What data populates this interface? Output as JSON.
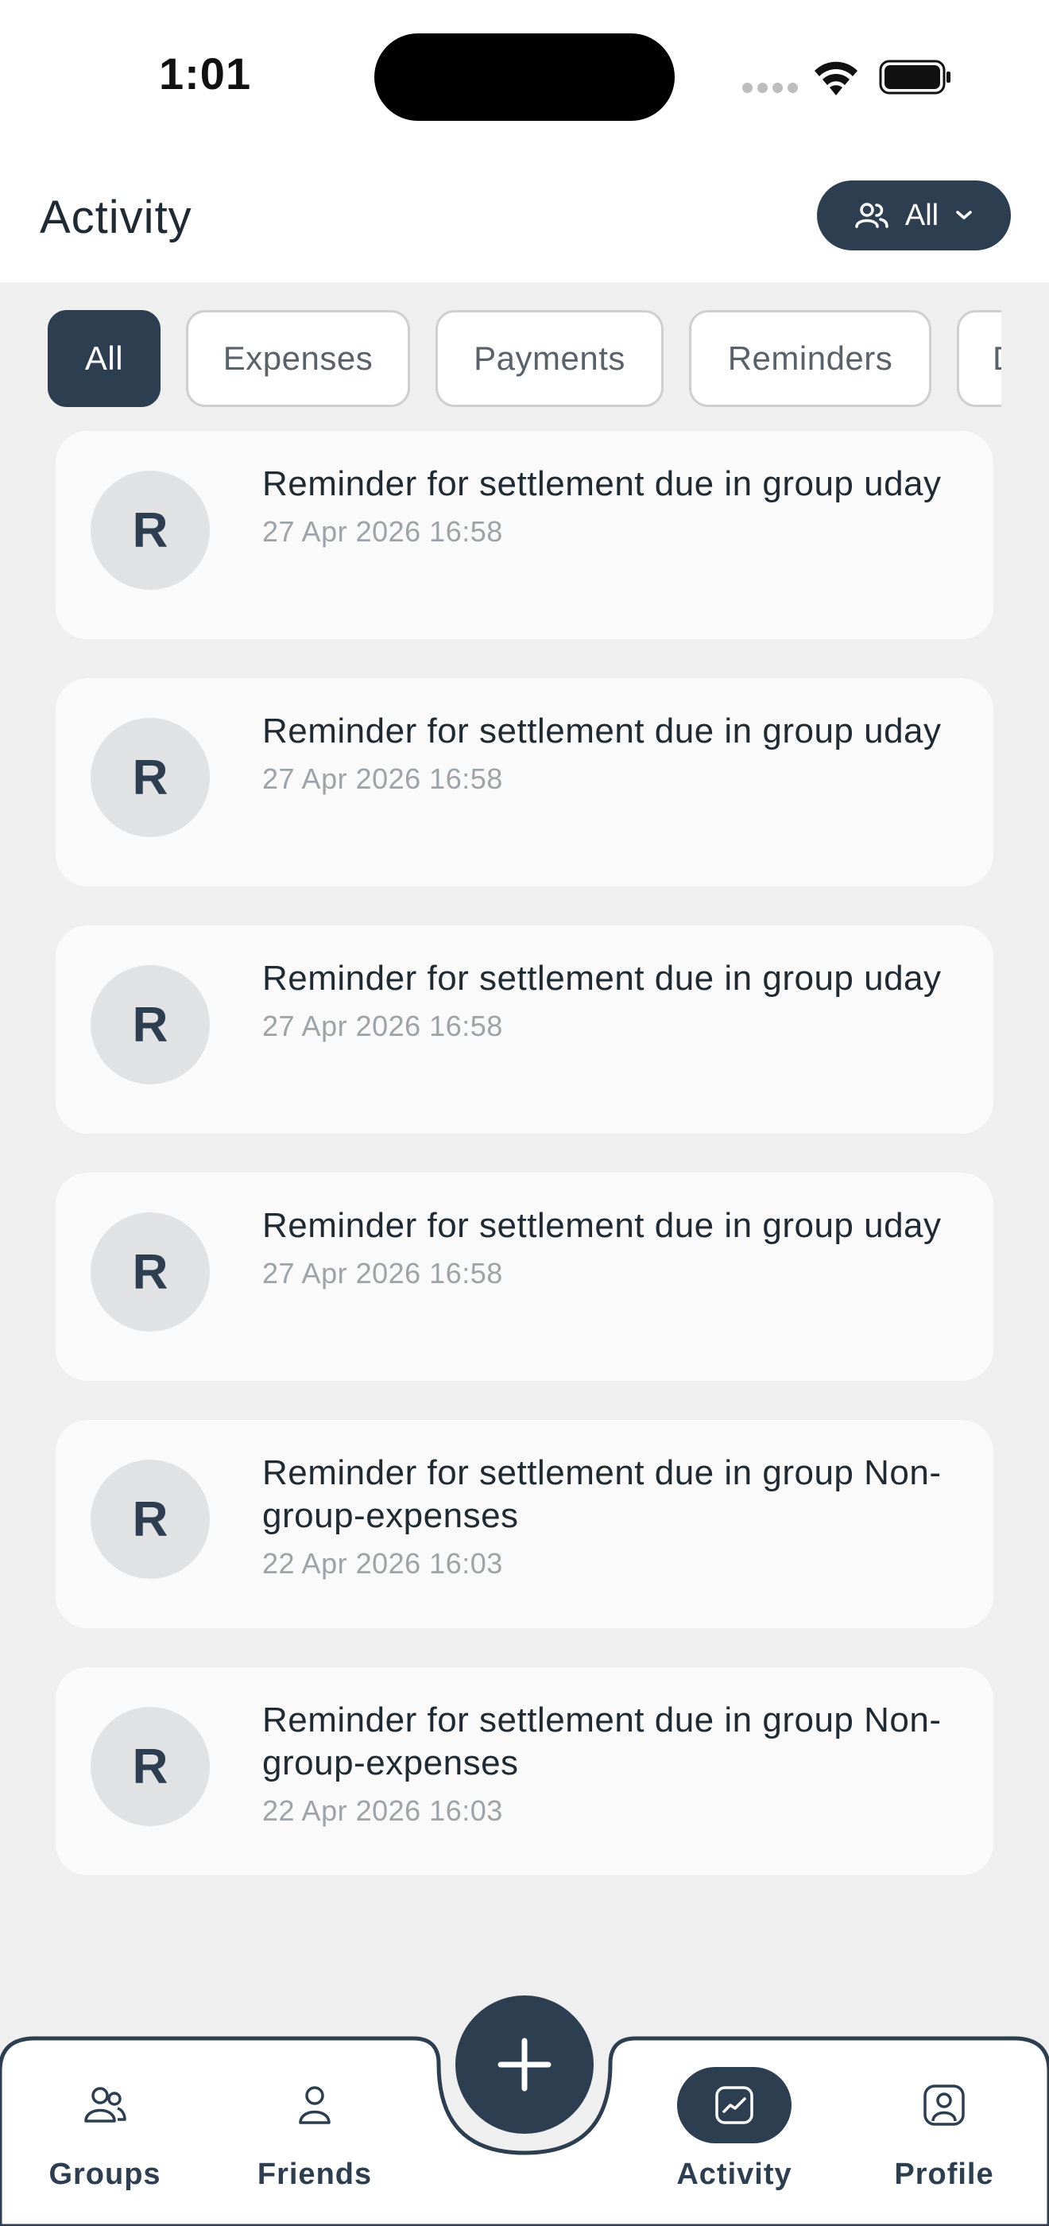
{
  "status_bar": {
    "time": "1:01"
  },
  "header": {
    "title": "Activity",
    "scope_button_label": "All"
  },
  "filters": [
    {
      "label": "All",
      "active": true
    },
    {
      "label": "Expenses",
      "active": false
    },
    {
      "label": "Payments",
      "active": false
    },
    {
      "label": "Reminders",
      "active": false
    },
    {
      "label": "D",
      "active": false
    }
  ],
  "activities": [
    {
      "avatar": "R",
      "title": "Reminder for settlement due in group uday",
      "time": "27 Apr 2026 16:58"
    },
    {
      "avatar": "R",
      "title": "Reminder for settlement due in group uday",
      "time": "27 Apr 2026 16:58"
    },
    {
      "avatar": "R",
      "title": "Reminder for settlement due in group uday",
      "time": "27 Apr 2026 16:58"
    },
    {
      "avatar": "R",
      "title": "Reminder for settlement due in group uday",
      "time": "27 Apr 2026 16:58"
    },
    {
      "avatar": "R",
      "title": "Reminder for settlement due in group Non-group-expenses",
      "time": "22 Apr 2026 16:03"
    },
    {
      "avatar": "R",
      "title": "Reminder for settlement due in group Non-group-expenses",
      "time": "22 Apr 2026 16:03"
    }
  ],
  "bottom_nav": {
    "items": [
      {
        "label": "Groups",
        "icon": "groups-icon",
        "active": false
      },
      {
        "label": "Friends",
        "icon": "friends-icon",
        "active": false
      },
      {
        "label": "Activity",
        "icon": "activity-icon",
        "active": true
      },
      {
        "label": "Profile",
        "icon": "profile-icon",
        "active": false
      }
    ],
    "fab_icon": "plus-icon"
  },
  "colors": {
    "primary": "#2c3e50",
    "background": "#efefef",
    "card": "#fafafa",
    "avatar_bg": "#e1e2e4",
    "muted_text": "#9ea3a8"
  }
}
